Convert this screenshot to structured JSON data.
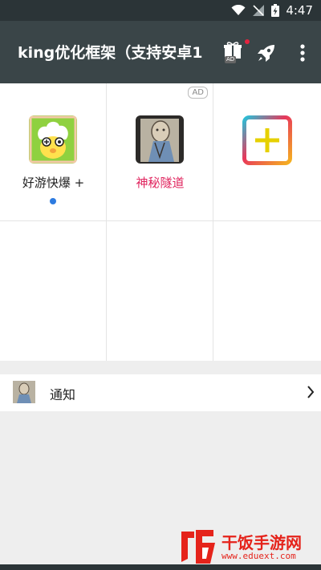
{
  "status_bar": {
    "time": "4:47"
  },
  "toolbar": {
    "title": "king优化框架（支持安卓1",
    "gift_ad_label": "AD"
  },
  "apps": [
    {
      "label": "好游快爆 +",
      "has_dot": true
    },
    {
      "label": "神秘隧道",
      "ad_badge": "AD",
      "label_color": "#e0245e"
    },
    {
      "label": ""
    }
  ],
  "notification": {
    "label": "通知"
  },
  "watermark": {
    "title": "干饭手游网",
    "url": "www.eduext.com"
  },
  "colors": {
    "status_bar": "#2b3437",
    "toolbar": "#3a4548",
    "accent_red": "#e0245e",
    "dot_blue": "#2d7be0",
    "background": "#eeeeee"
  }
}
